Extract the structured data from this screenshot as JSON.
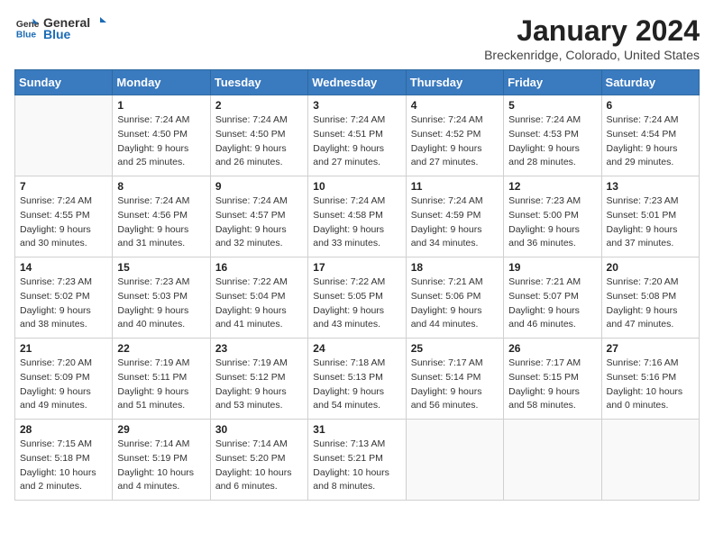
{
  "header": {
    "logo_general": "General",
    "logo_blue": "Blue",
    "month_title": "January 2024",
    "location": "Breckenridge, Colorado, United States"
  },
  "weekdays": [
    "Sunday",
    "Monday",
    "Tuesday",
    "Wednesday",
    "Thursday",
    "Friday",
    "Saturday"
  ],
  "weeks": [
    [
      {
        "day": "",
        "info": ""
      },
      {
        "day": "1",
        "info": "Sunrise: 7:24 AM\nSunset: 4:50 PM\nDaylight: 9 hours\nand 25 minutes."
      },
      {
        "day": "2",
        "info": "Sunrise: 7:24 AM\nSunset: 4:50 PM\nDaylight: 9 hours\nand 26 minutes."
      },
      {
        "day": "3",
        "info": "Sunrise: 7:24 AM\nSunset: 4:51 PM\nDaylight: 9 hours\nand 27 minutes."
      },
      {
        "day": "4",
        "info": "Sunrise: 7:24 AM\nSunset: 4:52 PM\nDaylight: 9 hours\nand 27 minutes."
      },
      {
        "day": "5",
        "info": "Sunrise: 7:24 AM\nSunset: 4:53 PM\nDaylight: 9 hours\nand 28 minutes."
      },
      {
        "day": "6",
        "info": "Sunrise: 7:24 AM\nSunset: 4:54 PM\nDaylight: 9 hours\nand 29 minutes."
      }
    ],
    [
      {
        "day": "7",
        "info": "Sunrise: 7:24 AM\nSunset: 4:55 PM\nDaylight: 9 hours\nand 30 minutes."
      },
      {
        "day": "8",
        "info": "Sunrise: 7:24 AM\nSunset: 4:56 PM\nDaylight: 9 hours\nand 31 minutes."
      },
      {
        "day": "9",
        "info": "Sunrise: 7:24 AM\nSunset: 4:57 PM\nDaylight: 9 hours\nand 32 minutes."
      },
      {
        "day": "10",
        "info": "Sunrise: 7:24 AM\nSunset: 4:58 PM\nDaylight: 9 hours\nand 33 minutes."
      },
      {
        "day": "11",
        "info": "Sunrise: 7:24 AM\nSunset: 4:59 PM\nDaylight: 9 hours\nand 34 minutes."
      },
      {
        "day": "12",
        "info": "Sunrise: 7:23 AM\nSunset: 5:00 PM\nDaylight: 9 hours\nand 36 minutes."
      },
      {
        "day": "13",
        "info": "Sunrise: 7:23 AM\nSunset: 5:01 PM\nDaylight: 9 hours\nand 37 minutes."
      }
    ],
    [
      {
        "day": "14",
        "info": "Sunrise: 7:23 AM\nSunset: 5:02 PM\nDaylight: 9 hours\nand 38 minutes."
      },
      {
        "day": "15",
        "info": "Sunrise: 7:23 AM\nSunset: 5:03 PM\nDaylight: 9 hours\nand 40 minutes."
      },
      {
        "day": "16",
        "info": "Sunrise: 7:22 AM\nSunset: 5:04 PM\nDaylight: 9 hours\nand 41 minutes."
      },
      {
        "day": "17",
        "info": "Sunrise: 7:22 AM\nSunset: 5:05 PM\nDaylight: 9 hours\nand 43 minutes."
      },
      {
        "day": "18",
        "info": "Sunrise: 7:21 AM\nSunset: 5:06 PM\nDaylight: 9 hours\nand 44 minutes."
      },
      {
        "day": "19",
        "info": "Sunrise: 7:21 AM\nSunset: 5:07 PM\nDaylight: 9 hours\nand 46 minutes."
      },
      {
        "day": "20",
        "info": "Sunrise: 7:20 AM\nSunset: 5:08 PM\nDaylight: 9 hours\nand 47 minutes."
      }
    ],
    [
      {
        "day": "21",
        "info": "Sunrise: 7:20 AM\nSunset: 5:09 PM\nDaylight: 9 hours\nand 49 minutes."
      },
      {
        "day": "22",
        "info": "Sunrise: 7:19 AM\nSunset: 5:11 PM\nDaylight: 9 hours\nand 51 minutes."
      },
      {
        "day": "23",
        "info": "Sunrise: 7:19 AM\nSunset: 5:12 PM\nDaylight: 9 hours\nand 53 minutes."
      },
      {
        "day": "24",
        "info": "Sunrise: 7:18 AM\nSunset: 5:13 PM\nDaylight: 9 hours\nand 54 minutes."
      },
      {
        "day": "25",
        "info": "Sunrise: 7:17 AM\nSunset: 5:14 PM\nDaylight: 9 hours\nand 56 minutes."
      },
      {
        "day": "26",
        "info": "Sunrise: 7:17 AM\nSunset: 5:15 PM\nDaylight: 9 hours\nand 58 minutes."
      },
      {
        "day": "27",
        "info": "Sunrise: 7:16 AM\nSunset: 5:16 PM\nDaylight: 10 hours\nand 0 minutes."
      }
    ],
    [
      {
        "day": "28",
        "info": "Sunrise: 7:15 AM\nSunset: 5:18 PM\nDaylight: 10 hours\nand 2 minutes."
      },
      {
        "day": "29",
        "info": "Sunrise: 7:14 AM\nSunset: 5:19 PM\nDaylight: 10 hours\nand 4 minutes."
      },
      {
        "day": "30",
        "info": "Sunrise: 7:14 AM\nSunset: 5:20 PM\nDaylight: 10 hours\nand 6 minutes."
      },
      {
        "day": "31",
        "info": "Sunrise: 7:13 AM\nSunset: 5:21 PM\nDaylight: 10 hours\nand 8 minutes."
      },
      {
        "day": "",
        "info": ""
      },
      {
        "day": "",
        "info": ""
      },
      {
        "day": "",
        "info": ""
      }
    ]
  ]
}
